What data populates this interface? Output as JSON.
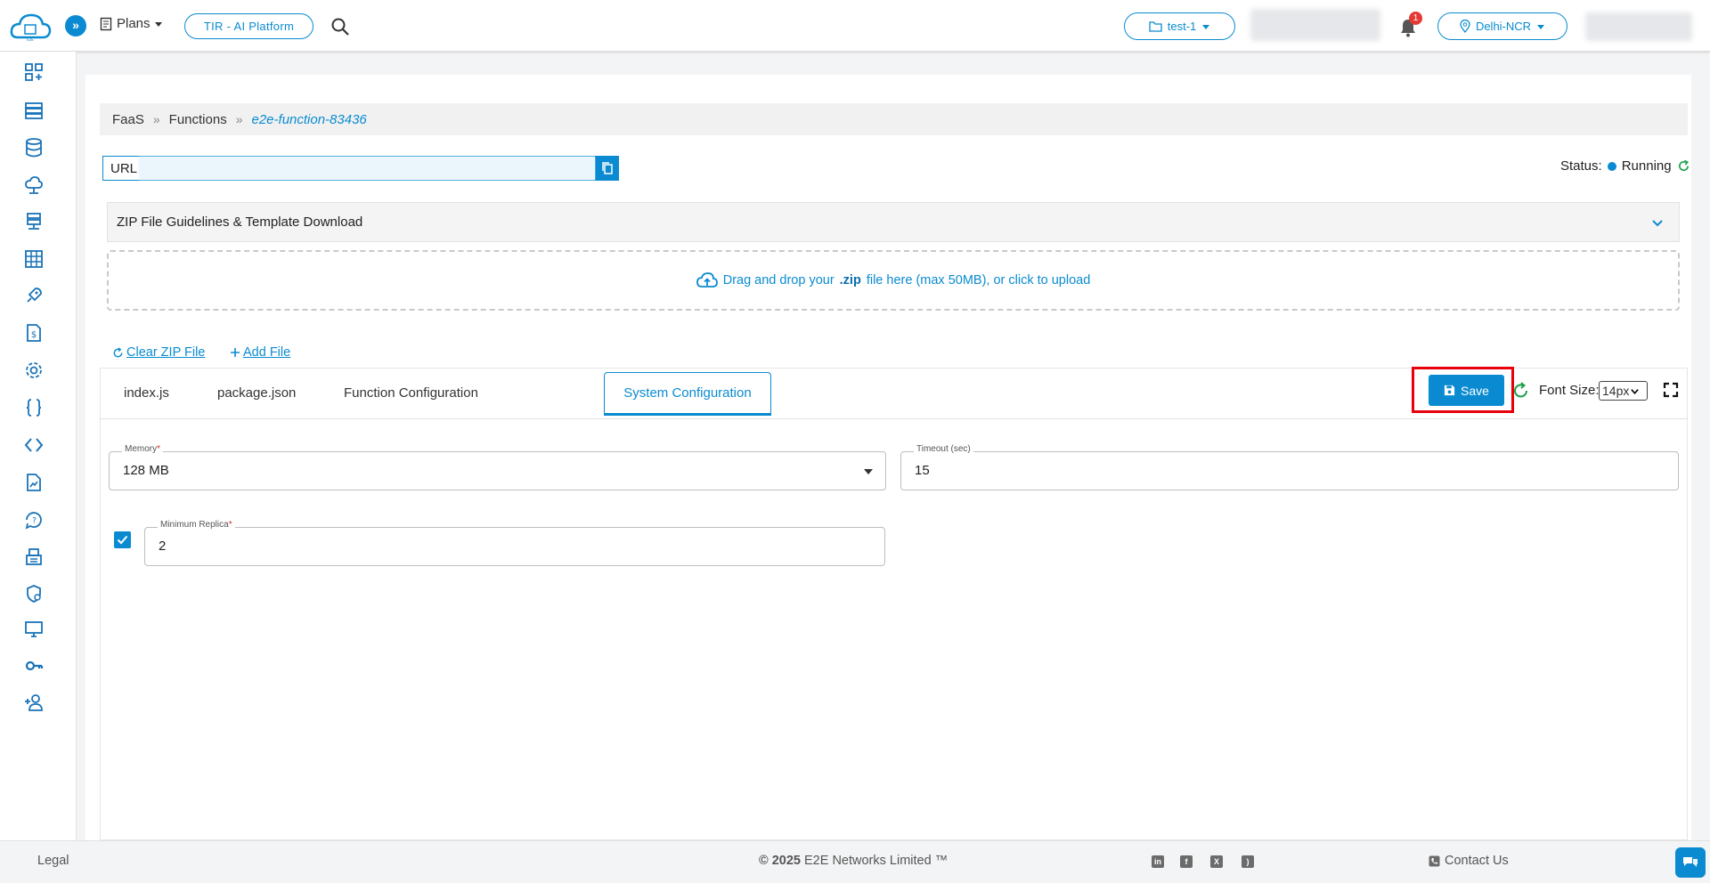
{
  "header": {
    "plans_label": "Plans",
    "platform_button": "TIR - AI Platform",
    "project_label": "test-1",
    "notification_count": "1",
    "region_label": "Delhi-NCR"
  },
  "breadcrumb": {
    "items": [
      "FaaS",
      "Functions"
    ],
    "separator": "»",
    "current": "e2e-function-83436"
  },
  "url": {
    "label": "URL"
  },
  "status": {
    "label": "Status:",
    "value": "Running"
  },
  "accordion": {
    "title": "ZIP File Guidelines & Template Download"
  },
  "dropzone": {
    "text_before": "Drag and drop your",
    "bold": ".zip",
    "text_after": "file here (max 50MB), or click to upload"
  },
  "actions": {
    "clear_zip": "Clear ZIP File",
    "add_file": "Add File"
  },
  "tabs": [
    "index.js",
    "package.json",
    "Function Configuration",
    "System Configuration"
  ],
  "active_tab": "System Configuration",
  "toolbar": {
    "save_label": "Save",
    "font_size_label": "Font Size:",
    "font_size_value": "14px"
  },
  "form": {
    "memory": {
      "label": "Memory",
      "value": "128 MB"
    },
    "timeout": {
      "label": "Timeout (sec)",
      "value": "15"
    },
    "min_replica": {
      "label": "Minimum Replica",
      "value": "2",
      "checked": true
    }
  },
  "footer": {
    "legal": "Legal",
    "copyright_prefix": "© 2025",
    "copyright_rest": "E2E Networks Limited ™",
    "social": [
      "linkedin-icon",
      "facebook-icon",
      "x-icon",
      "rss-icon"
    ],
    "contact": "Contact Us"
  },
  "colors": {
    "accent": "#0a8bd1",
    "highlight": "#e8000b",
    "status_refresh": "#1aa34a"
  }
}
